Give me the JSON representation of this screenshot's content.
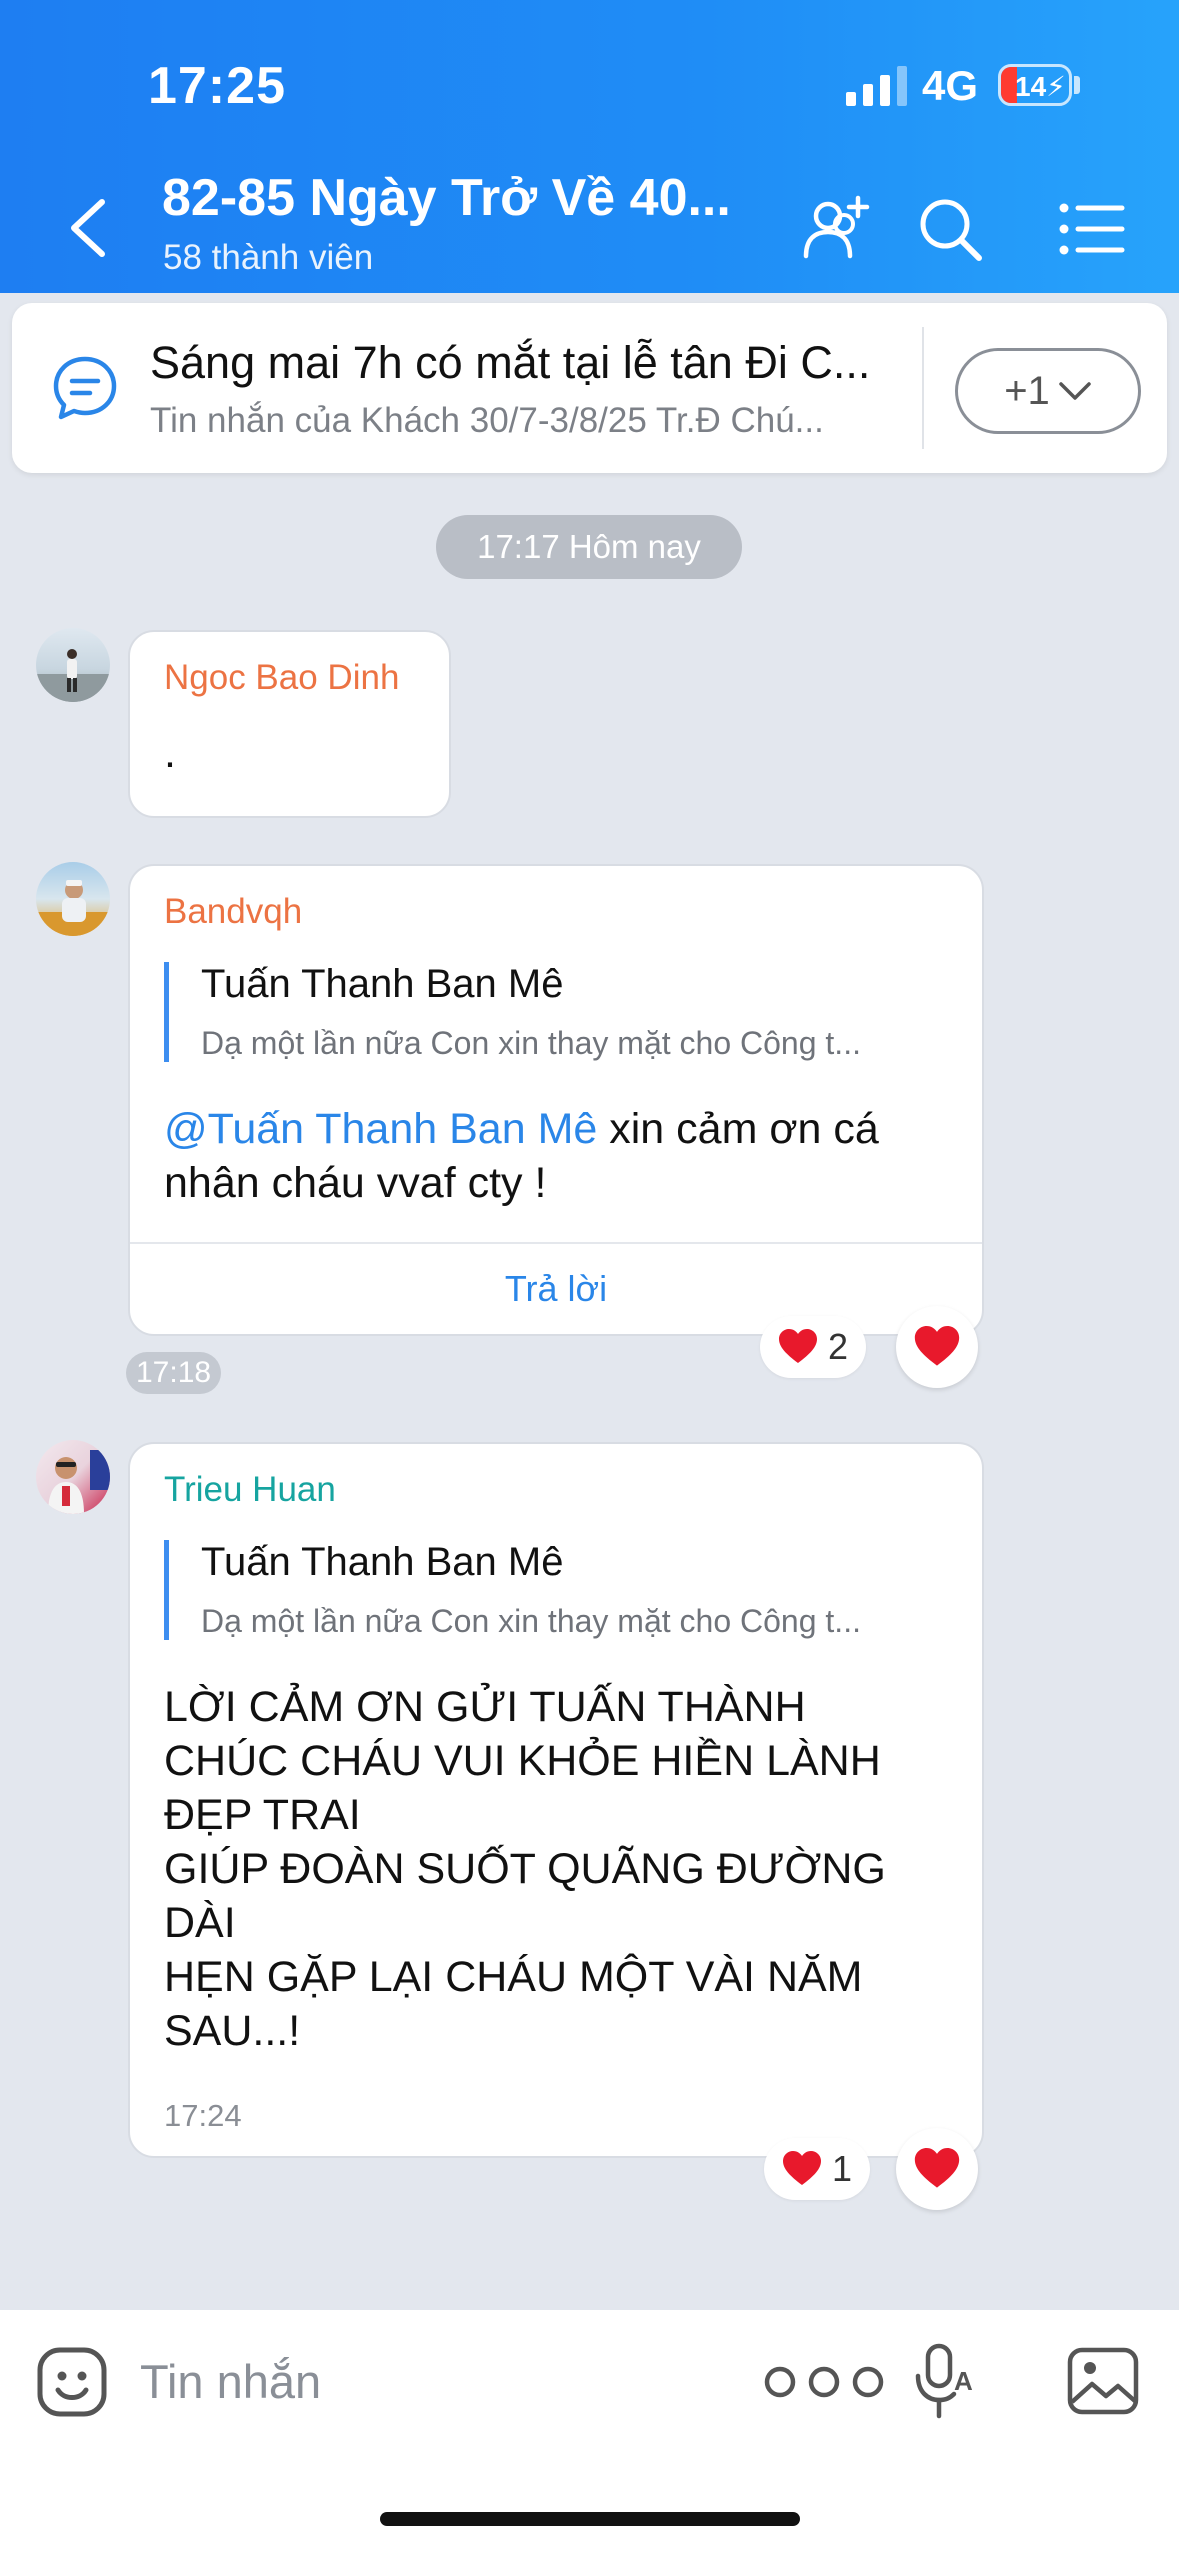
{
  "status": {
    "time": "17:25",
    "network": "4G",
    "battery": "14"
  },
  "header": {
    "title": "82-85 Ngày Trở Về 40...",
    "subtitle": "58 thành viên"
  },
  "pinned": {
    "main": "Sáng mai 7h có mắt tại lễ tân Đi C...",
    "sub": "Tin nhắn của Khách 30/7-3/8/25 Tr.Đ Chú...",
    "count": "+1"
  },
  "date_pill": "17:17 Hôm nay",
  "messages": [
    {
      "sender": "Ngoc Bao Dinh",
      "text": "."
    },
    {
      "sender": "Bandvqh",
      "quote_name": "Tuấn Thanh Ban Mê",
      "quote_text": "Dạ một lần nữa Con xin thay mặt cho Công t...",
      "mention": "@Tuấn Thanh Ban Mê",
      "text_line1_rest": " xin cảm ơn cá",
      "text_line2": "nhân cháu vvaf cty !",
      "reply_label": "Trả lời",
      "time": "17:18",
      "reaction_count": "2"
    },
    {
      "sender": "Trieu Huan",
      "quote_name": "Tuấn Thanh Ban Mê",
      "quote_text": "Dạ một lần nữa Con xin thay mặt cho Công t...",
      "lines": [
        "LỜI CẢM ƠN GỬI TUẤN THÀNH",
        "CHÚC CHÁU VUI KHỎE HIỀN LÀNH",
        "ĐẸP TRAI",
        "GIÚP ĐOÀN SUỐT QUÃNG ĐƯỜNG",
        "DÀI",
        "HẸN GẶP LẠI CHÁU MỘT VÀI NĂM",
        "SAU...!"
      ],
      "time": "17:24",
      "reaction_count": "1"
    }
  ],
  "input": {
    "placeholder": "Tin nhắn"
  },
  "icons": {
    "back": "chevron-left-icon",
    "add_member": "add-member-icon",
    "search": "search-icon",
    "menu": "list-menu-icon",
    "pinned": "chat-bubble-icon",
    "heart": "heart-icon",
    "emoji": "emoji-icon",
    "more": "more-dots-icon",
    "voice": "voice-text-icon",
    "image": "image-icon"
  },
  "colors": {
    "header": "#1f8df6",
    "accent": "#2a86e8",
    "heart": "#e8192c"
  }
}
